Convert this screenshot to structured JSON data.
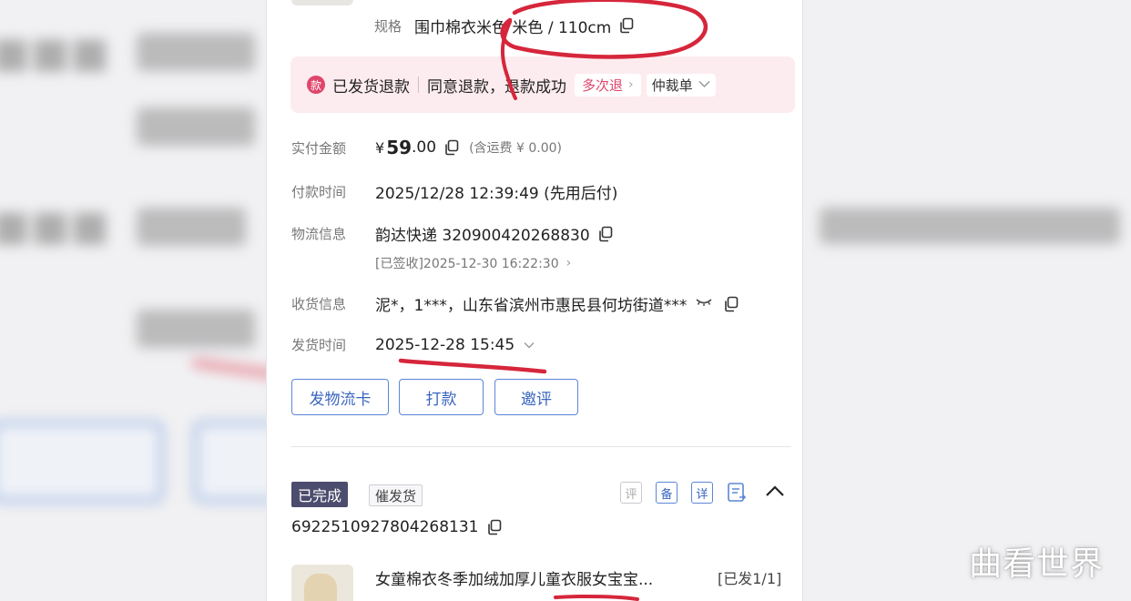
{
  "spec": {
    "label": "规格",
    "value": "围巾棉衣米色 米色 / 110cm"
  },
  "refund": {
    "badge": "款",
    "type": "已发货退款",
    "status": "同意退款，退款成功",
    "multi_label": "多次退",
    "arbitration_label": "仲裁单"
  },
  "payment": {
    "label": "实付金额",
    "currency": "¥",
    "amount": "59",
    "amount_decimal": ".00",
    "shipping_note": "(含运费 ¥ 0.00)"
  },
  "pay_time": {
    "label": "付款时间",
    "value": "2025/12/28 12:39:49 (先用后付)"
  },
  "logistics": {
    "label": "物流信息",
    "value": "韵达快递 320900420268830",
    "sub": "[已签收]2025-12-30 16:22:30"
  },
  "receiver": {
    "label": "收货信息",
    "value": "泥*，1***，山东省滨州市惠民县何坊街道***"
  },
  "ship_time": {
    "label": "发货时间",
    "value": "2025-12-28 15:45"
  },
  "actions": {
    "logistics_card": "发物流卡",
    "pay": "打款",
    "invite_review": "邀评"
  },
  "order2": {
    "status_tag": "已完成",
    "urge_tag": "催发货",
    "icons": [
      {
        "name": "review-icon",
        "glyph": "评",
        "active": false
      },
      {
        "name": "note-icon",
        "glyph": "备",
        "active": true
      },
      {
        "name": "detail-icon",
        "glyph": "详",
        "active": true
      },
      {
        "name": "edit-doc-icon",
        "glyph": "",
        "active": true
      }
    ],
    "order_id": "6922510927804268131",
    "product_title": "女童棉衣冬季加绒加厚儿童衣服女宝宝...",
    "shipped_count": "[已发1/1]"
  },
  "watermark": "曲看世界",
  "colors": {
    "accent_blue": "#3a66bf",
    "refund_pink": "#e0456b",
    "annotation_red": "#d6263b"
  }
}
